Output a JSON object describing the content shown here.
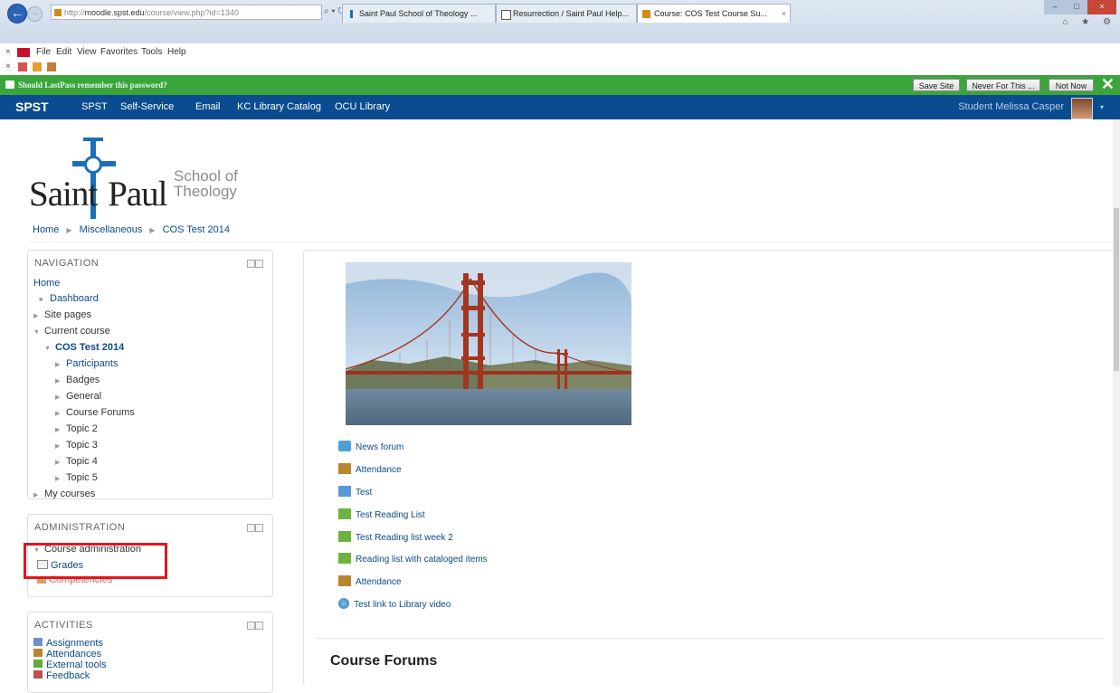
{
  "browser": {
    "url_prefix": "http://",
    "url_host": "moodle.spst.edu",
    "url_path": "/course/view.php?id=1340",
    "address_controls": "⌕ ▾ ↻",
    "tabs": [
      {
        "title": "Saint Paul School of Theology ...",
        "active": false
      },
      {
        "title": "Resurrection / Saint Paul Help...",
        "active": false
      },
      {
        "title": "Course: COS Test Course Su...",
        "active": true
      }
    ],
    "tab_close_glyph": "×",
    "window_controls": {
      "minimize": "–",
      "maximize": "□",
      "close": "×"
    },
    "right_icons": "⌂ ★ ⚙",
    "menu": [
      "File",
      "Edit",
      "View",
      "Favorites",
      "Tools",
      "Help"
    ],
    "menu_close": "×",
    "toolbar_close": "×"
  },
  "lastpass": {
    "message": "Should LastPass remember this password?",
    "buttons": [
      "Save Site",
      "Never For This ...",
      "Not Now"
    ],
    "close": "✕"
  },
  "sitenav": {
    "brand": "SPST",
    "items": [
      "SPST",
      "Self-Service",
      "Email",
      "KC Library Catalog",
      "OCU Library"
    ],
    "user": "Student Melissa Casper",
    "user_caret": "▾"
  },
  "logo": {
    "saint": "Saint",
    "paul": "Paul",
    "school_line1": "School of",
    "school_line2": "Theology"
  },
  "breadcrumb": [
    "Home",
    "Miscellaneous",
    "COS Test 2014"
  ],
  "breadcrumb_sep": "▶",
  "navigation": {
    "title": "NAVIGATION",
    "home": "Home",
    "dashboard": "Dashboard",
    "site_pages": "Site pages",
    "current_course": "Current course",
    "course": "COS Test 2014",
    "course_items": [
      "Participants",
      "Badges",
      "General",
      "Course Forums",
      "Topic 2",
      "Topic 3",
      "Topic 4",
      "Topic 5"
    ],
    "my_courses": "My courses"
  },
  "administration": {
    "title": "ADMINISTRATION",
    "course_admin": "Course administration",
    "grades": "Grades",
    "competencies": "Competencies"
  },
  "activities": {
    "title": "ACTIVITIES",
    "items": [
      "Assignments",
      "Attendances",
      "External tools",
      "Feedback"
    ]
  },
  "main": {
    "activities": [
      {
        "label": "News forum",
        "icon": "forum-icon"
      },
      {
        "label": "Attendance",
        "icon": "attendance-icon"
      },
      {
        "label": "Test",
        "icon": "folder-icon"
      },
      {
        "label": "Test Reading List",
        "icon": "puzzle-icon"
      },
      {
        "label": "Test Reading list week 2",
        "icon": "puzzle-icon"
      },
      {
        "label": "Reading list with cataloged items",
        "icon": "puzzle-icon"
      },
      {
        "label": "Attendance",
        "icon": "attendance-icon"
      },
      {
        "label": "Test link to Library video",
        "icon": "url-globe-icon"
      }
    ],
    "section_title": "Course Forums"
  },
  "colors": {
    "site_nav": "#0a4c8f",
    "lastpass_bar": "#3aa53c",
    "link": "#0b4a8b",
    "highlight": "#e2161b"
  },
  "glyphs": {
    "collapsed": "▶",
    "expanded": "▼",
    "bullet": "■"
  }
}
